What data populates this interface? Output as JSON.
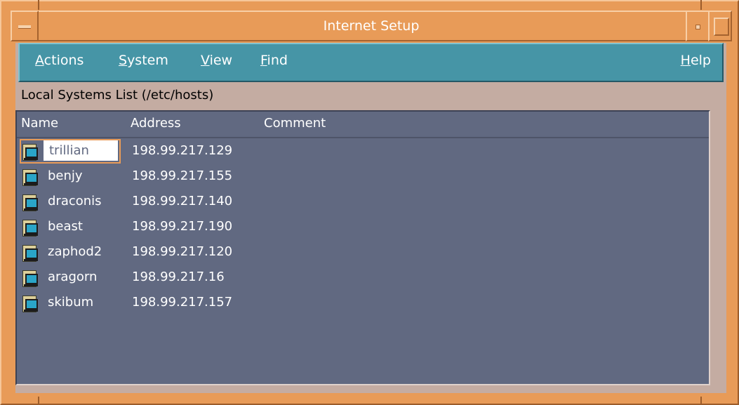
{
  "window": {
    "title": "Internet Setup"
  },
  "menubar": {
    "items": [
      {
        "label_mn": "A",
        "label_rest": "ctions"
      },
      {
        "label_mn": "S",
        "label_rest": "ystem"
      },
      {
        "label_mn": "V",
        "label_rest": "iew"
      },
      {
        "label_mn": "F",
        "label_rest": "ind"
      }
    ],
    "help": {
      "label_mn": "H",
      "label_rest": "elp"
    }
  },
  "list": {
    "label": "Local Systems List (/etc/hosts)",
    "columns": [
      "Name",
      "Address",
      "Comment"
    ],
    "rows": [
      {
        "name": "trillian",
        "address": "198.99.217.129",
        "comment": ""
      },
      {
        "name": "benjy",
        "address": "198.99.217.155",
        "comment": ""
      },
      {
        "name": "draconis",
        "address": "198.99.217.140",
        "comment": ""
      },
      {
        "name": "beast",
        "address": "198.99.217.190",
        "comment": ""
      },
      {
        "name": "zaphod2",
        "address": "198.99.217.120",
        "comment": ""
      },
      {
        "name": "aragorn",
        "address": "198.99.217.16",
        "comment": ""
      },
      {
        "name": "skibum",
        "address": "198.99.217.157",
        "comment": ""
      }
    ],
    "selected_index": 0
  },
  "icons": {
    "row_icon": "computer-host-icon",
    "window_menu": "window-menu-icon",
    "minimize": "minimize-icon",
    "maximize": "maximize-icon"
  },
  "colors": {
    "frame": "#e89b58",
    "menubar": "#4695a6",
    "list_background": "#616981",
    "window_background": "#c4aca2"
  }
}
